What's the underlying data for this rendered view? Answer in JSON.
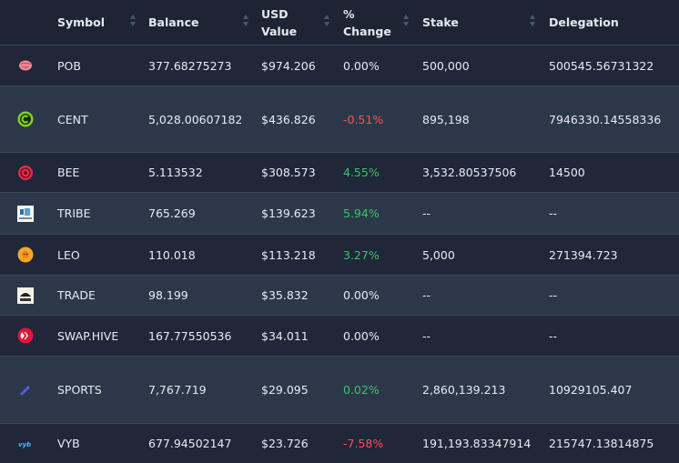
{
  "columns": {
    "symbol": "Symbol",
    "balance": "Balance",
    "usd_value_line1": "USD",
    "usd_value_line2": "Value",
    "change_line1": "%",
    "change_line2": "Change",
    "stake": "Stake",
    "delegation": "Delegation"
  },
  "rows": [
    {
      "symbol": "POB",
      "balance": "377.68275273",
      "usd": "$974.206",
      "change": "0.00%",
      "change_dir": "neutral",
      "stake": "500,000",
      "delegation": "500545.56731322",
      "icon": "brain-icon"
    },
    {
      "symbol": "CENT",
      "balance": "5,028.00607182",
      "usd": "$436.826",
      "change": "-0.51%",
      "change_dir": "neg",
      "stake": "895,198",
      "delegation": "7946330.14558336",
      "icon": "cent-coin-icon"
    },
    {
      "symbol": "BEE",
      "balance": "5.113532",
      "usd": "$308.573",
      "change": "4.55%",
      "change_dir": "pos",
      "stake": "3,532.80537506",
      "delegation": "14500",
      "icon": "bee-icon"
    },
    {
      "symbol": "TRIBE",
      "balance": "765.269",
      "usd": "$139.623",
      "change": "5.94%",
      "change_dir": "pos",
      "stake": "--",
      "delegation": "--",
      "icon": "tribe-icon"
    },
    {
      "symbol": "LEO",
      "balance": "110.018",
      "usd": "$113.218",
      "change": "3.27%",
      "change_dir": "pos",
      "stake": "5,000",
      "delegation": "271394.723",
      "icon": "lion-icon"
    },
    {
      "symbol": "TRADE",
      "balance": "98.199",
      "usd": "$35.832",
      "change": "0.00%",
      "change_dir": "neutral",
      "stake": "--",
      "delegation": "--",
      "icon": "trade-icon"
    },
    {
      "symbol": "SWAP.HIVE",
      "balance": "167.77550536",
      "usd": "$34.011",
      "change": "0.00%",
      "change_dir": "neutral",
      "stake": "--",
      "delegation": "--",
      "icon": "hive-icon"
    },
    {
      "symbol": "SPORTS",
      "balance": "7,767.719",
      "usd": "$29.095",
      "change": "0.02%",
      "change_dir": "pos",
      "stake": "2,860,139.213",
      "delegation": "10929105.407",
      "icon": "sports-icon"
    },
    {
      "symbol": "VYB",
      "balance": "677.94502147",
      "usd": "$23.726",
      "change": "-7.58%",
      "change_dir": "neg",
      "stake": "191,193.83347914",
      "delegation": "215747.13814875",
      "icon": "vyb-icon"
    }
  ],
  "colors": {
    "negative": "#ff4d57",
    "positive": "#36c56a",
    "row_alt": "#2c3849",
    "background": "#1e2738"
  }
}
